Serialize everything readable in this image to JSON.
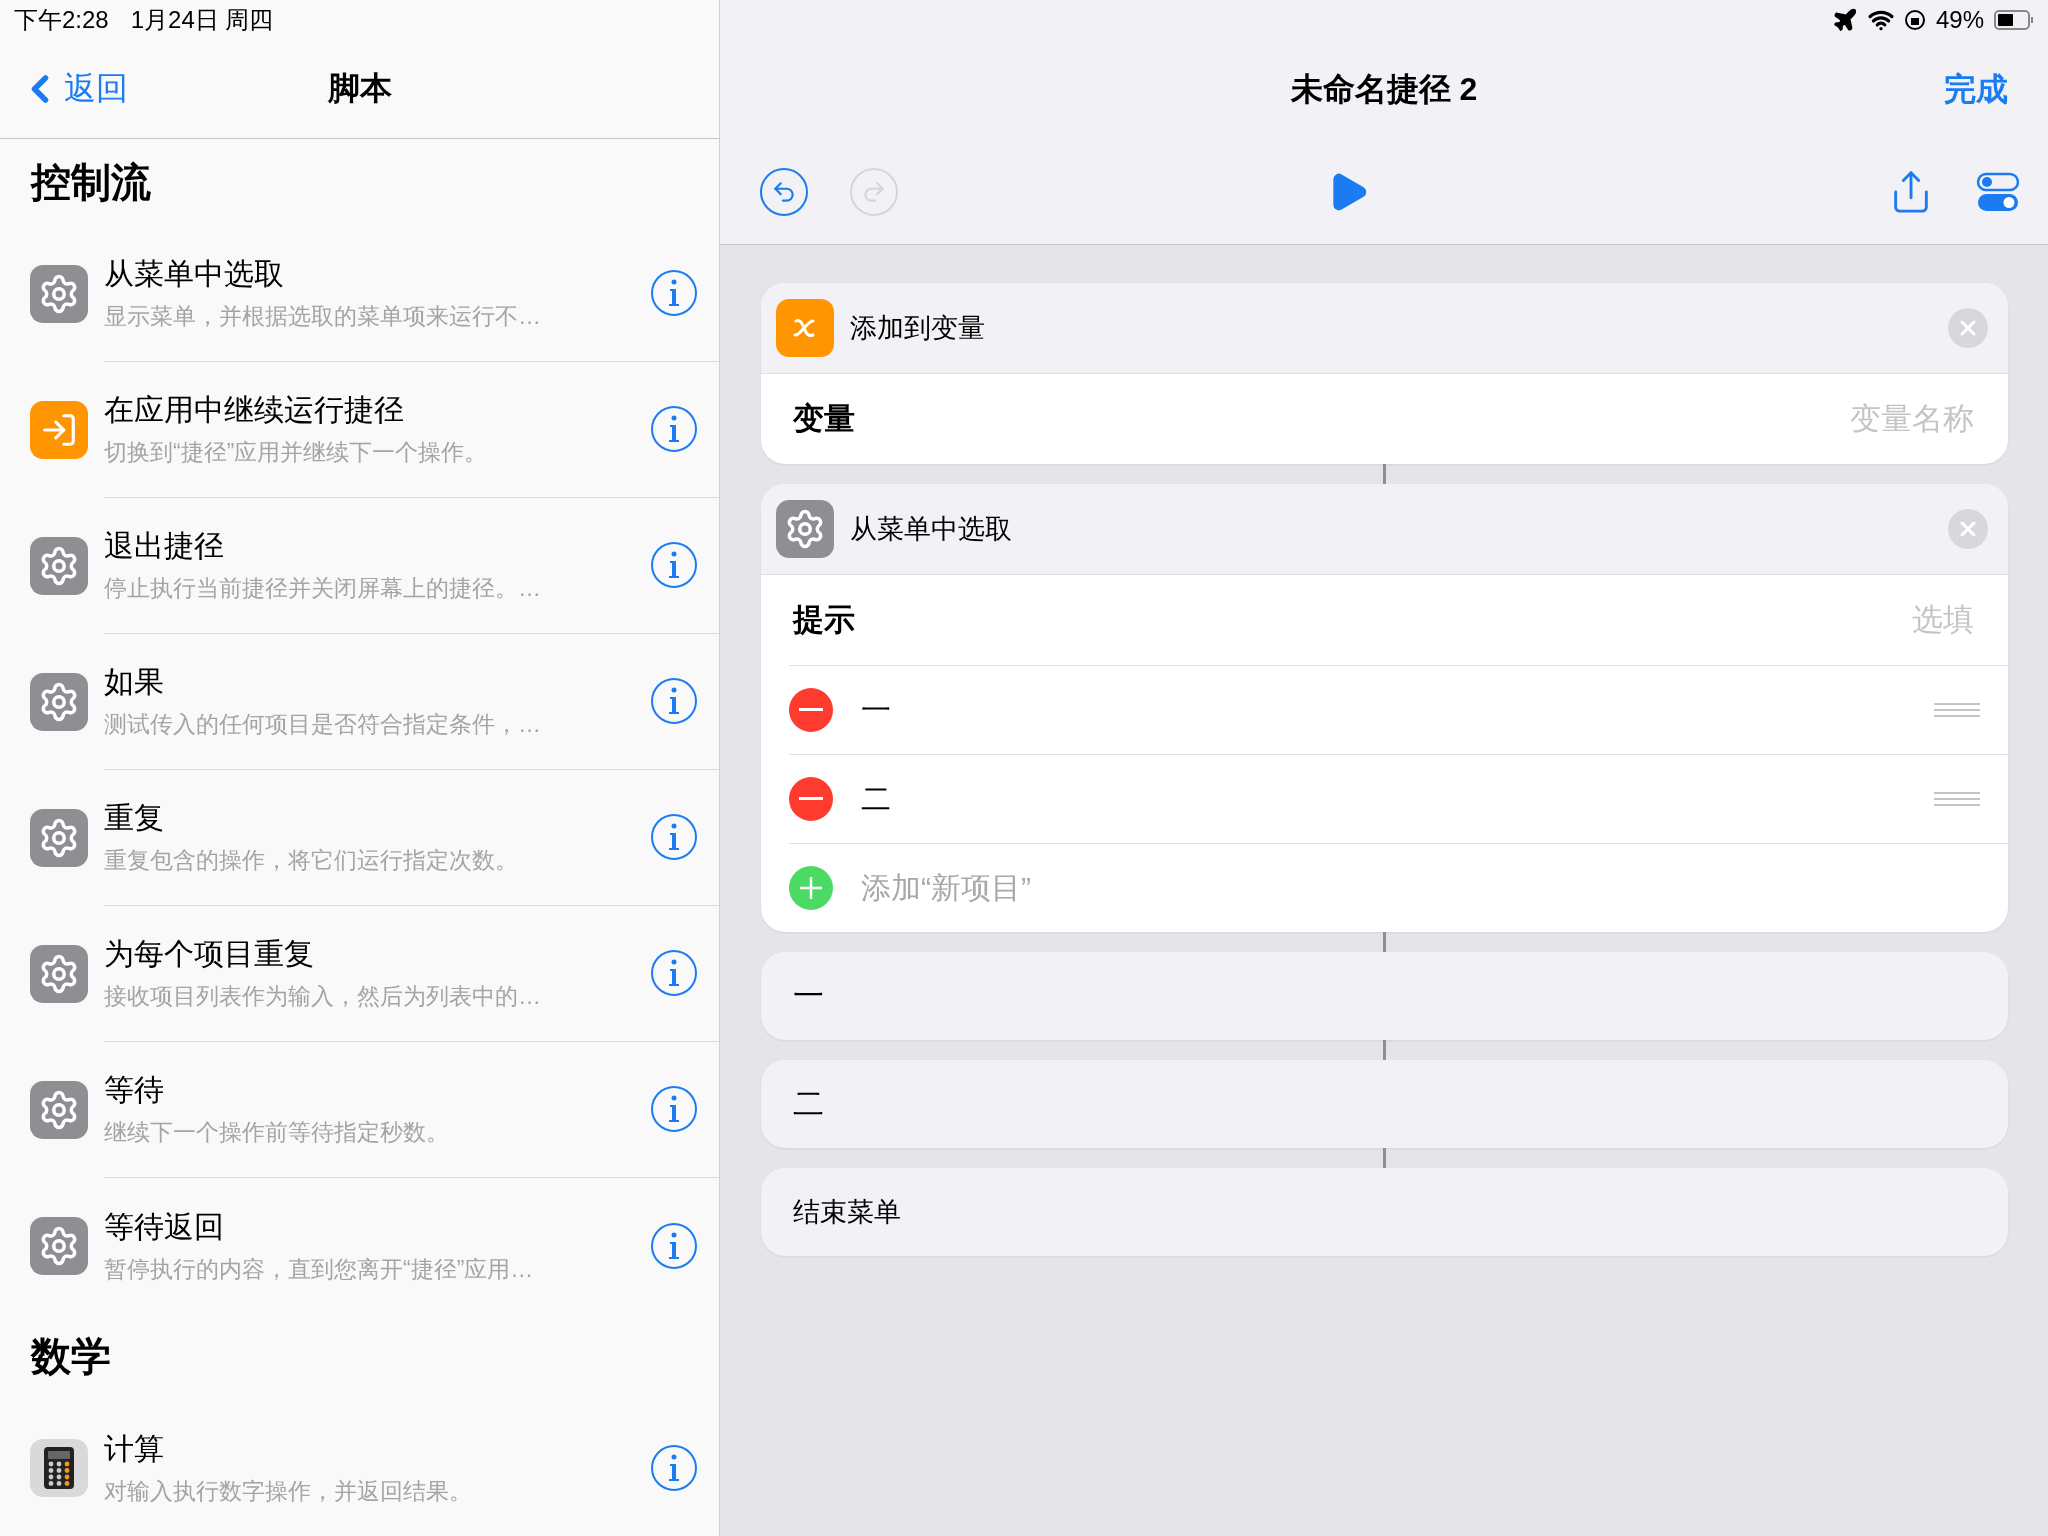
{
  "status_bar": {
    "time": "下午2:28",
    "date": "1月24日 周四",
    "battery": "49%"
  },
  "library": {
    "back": "返回",
    "title": "脚本",
    "sections": [
      {
        "title": "控制流",
        "items": [
          {
            "kind": "gear",
            "title": "从菜单中选取",
            "subtitle": "显示菜单，并根据选取的菜单项来运行不…"
          },
          {
            "kind": "shortcut",
            "title": "在应用中继续运行捷径",
            "subtitle": "切换到“捷径”应用并继续下一个操作。"
          },
          {
            "kind": "gear",
            "title": "退出捷径",
            "subtitle": "停止执行当前捷径并关闭屏幕上的捷径。…"
          },
          {
            "kind": "gear",
            "title": "如果",
            "subtitle": "测试传入的任何项目是否符合指定条件，…"
          },
          {
            "kind": "gear",
            "title": "重复",
            "subtitle": "重复包含的操作，将它们运行指定次数。"
          },
          {
            "kind": "gear",
            "title": "为每个项目重复",
            "subtitle": "接收项目列表作为输入，然后为列表中的…"
          },
          {
            "kind": "gear",
            "title": "等待",
            "subtitle": "继续下一个操作前等待指定秒数。"
          },
          {
            "kind": "gear",
            "title": "等待返回",
            "subtitle": "暂停执行的内容，直到您离开“捷径”应用…"
          }
        ]
      },
      {
        "title": "数学",
        "items": [
          {
            "kind": "calculator",
            "title": "计算",
            "subtitle": "对输入执行数字操作，并返回结果。"
          }
        ]
      }
    ]
  },
  "editor": {
    "title": "未命名捷径 2",
    "done": "完成",
    "toolbar": {
      "undo": {
        "disabled": false
      },
      "redo": {
        "disabled": true
      }
    },
    "actions": [
      {
        "kind": "variable",
        "title": "添加到变量",
        "field": {
          "label": "变量",
          "placeholder": "变量名称"
        }
      },
      {
        "kind": "menu",
        "title": "从菜单中选取",
        "field": {
          "label": "提示",
          "placeholder": "选填"
        },
        "items": [
          "一",
          "二"
        ],
        "add": "添加“新项目”"
      },
      {
        "kind": "block",
        "label": "一"
      },
      {
        "kind": "block",
        "label": "二"
      },
      {
        "kind": "end",
        "label": "结束菜单"
      }
    ]
  }
}
